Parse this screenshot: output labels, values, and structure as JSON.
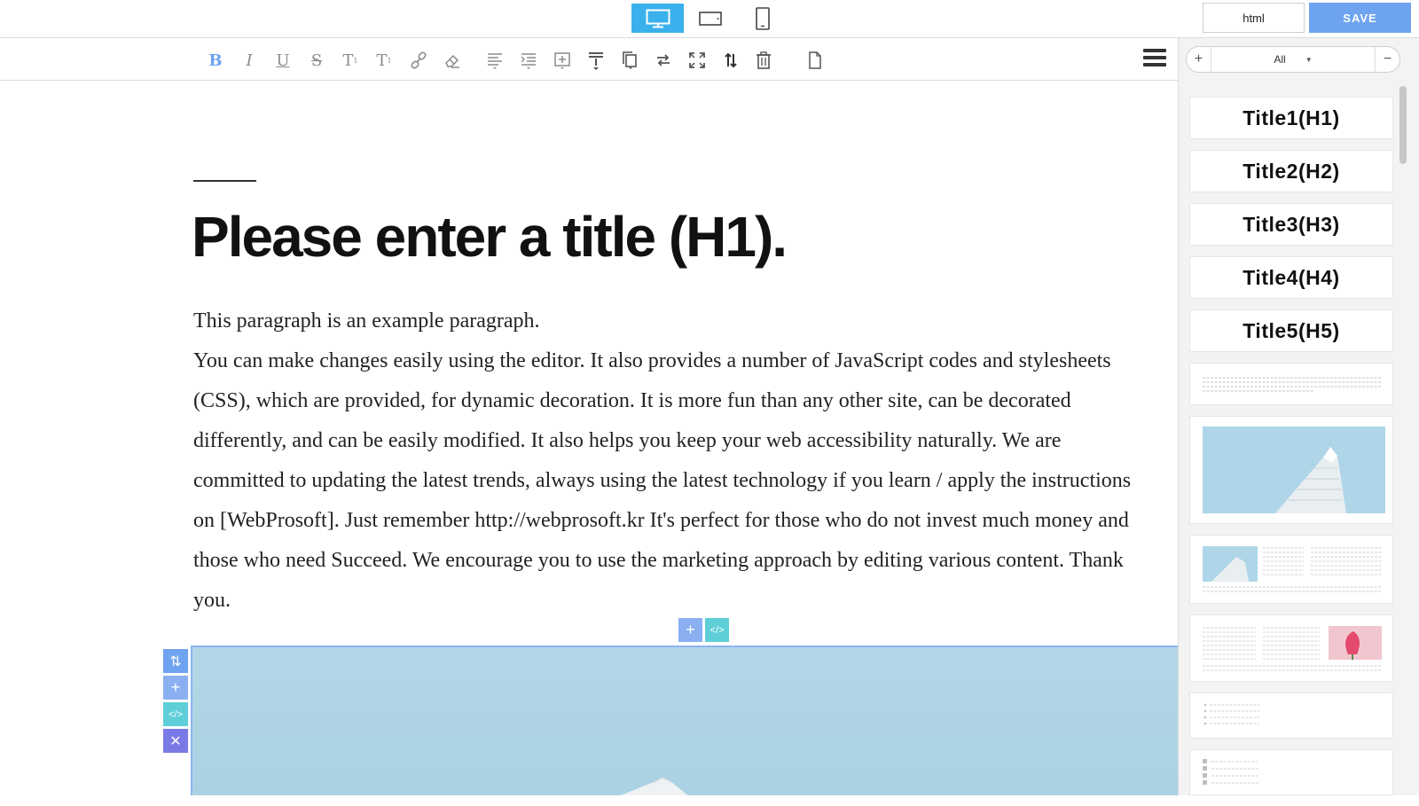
{
  "topbar": {
    "devices": [
      {
        "name": "desktop",
        "icon": "desktop-icon",
        "active": true
      },
      {
        "name": "tablet",
        "icon": "tablet-landscape-icon",
        "active": false
      },
      {
        "name": "mobile",
        "icon": "mobile-icon",
        "active": false
      }
    ],
    "html_label": "html",
    "save_label": "SAVE",
    "accent_color": "#3ab1ec",
    "save_color": "#6ea3f0"
  },
  "toolbar": {
    "tools": [
      "bold-icon",
      "italic-icon",
      "underline-icon",
      "strikethrough-icon",
      "superscript-icon",
      "subscript-icon",
      "link-icon",
      "eraser-icon",
      "align-icon",
      "indent-icon",
      "insert-block-icon",
      "insert-below-icon",
      "copy-icon",
      "swap-icon",
      "expand-icon",
      "move-icon",
      "trash-icon",
      "page-icon"
    ],
    "bold_glyph": "B",
    "italic_glyph": "I",
    "underline_glyph": "U",
    "strike_glyph": "S",
    "sup_glyph": "T",
    "sub_glyph": "T"
  },
  "sidebar": {
    "filter_plus": "+",
    "filter_value": "All",
    "filter_minus": "−",
    "title_templates": [
      "Title1(H1)",
      "Title2(H2)",
      "Title3(H3)",
      "Title4(H4)",
      "Title5(H5)"
    ]
  },
  "editor": {
    "heading": "Please enter a title (H1).",
    "paragraph_lines": [
      "This paragraph is an example paragraph.",
      "You can make changes easily using the editor. It also provides a number of JavaScript codes and stylesheets",
      "(CSS), which are provided, for dynamic decoration. It is more fun than any other site, can be decorated",
      "differently, and can be easily modified. It also helps you keep your web accessibility naturally. We are",
      "committed to updating the latest trends, always using the latest technology if you learn / apply the instructions",
      "on [WebProsoft]. Just remember http://webprosoft.kr It's perfect for those who do not invest much money and",
      "those who need Succeed. We encourage you to use the marketing approach by editing various content. Thank",
      "you."
    ],
    "block_controls": {
      "add": "+",
      "code": "</>",
      "move": "⇅",
      "close": "✕"
    }
  }
}
